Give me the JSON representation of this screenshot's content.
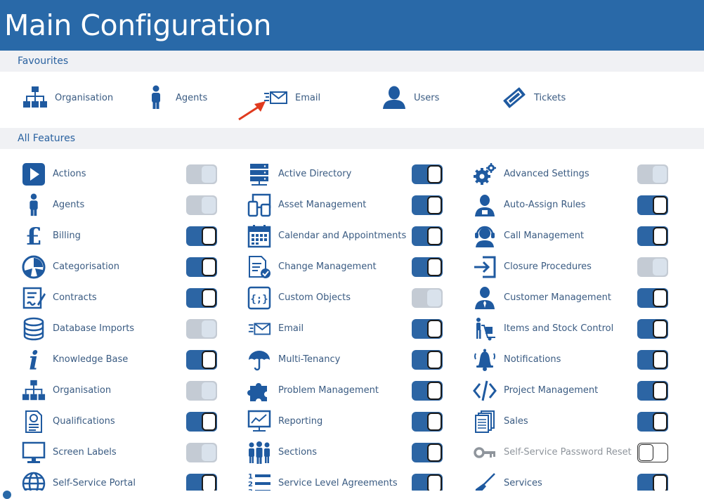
{
  "window": {
    "title": "Main Configuration"
  },
  "colors": {
    "brand": "#2969a8",
    "icon": "#1f5aa0",
    "toggle_on": "#2c65a4",
    "toggle_off": "#c4cbd4"
  },
  "favourites": {
    "heading": "Favourites",
    "items": [
      {
        "label": "Organisation",
        "icon": "org-chart-icon"
      },
      {
        "label": "Agents",
        "icon": "person-icon"
      },
      {
        "label": "Email",
        "icon": "email-icon"
      },
      {
        "label": "Users",
        "icon": "user-icon"
      },
      {
        "label": "Tickets",
        "icon": "ticket-icon"
      }
    ]
  },
  "all_features": {
    "heading": "All Features",
    "columns": [
      [
        {
          "label": "Actions",
          "icon": "play-icon",
          "state": "off"
        },
        {
          "label": "Agents",
          "icon": "person-icon",
          "state": "off"
        },
        {
          "label": "Billing",
          "icon": "pound-icon",
          "state": "on"
        },
        {
          "label": "Categorisation",
          "icon": "pie-chart-icon",
          "state": "on"
        },
        {
          "label": "Contracts",
          "icon": "contract-icon",
          "state": "on"
        },
        {
          "label": "Database Imports",
          "icon": "database-icon",
          "state": "off"
        },
        {
          "label": "Knowledge Base",
          "icon": "info-icon",
          "state": "on"
        },
        {
          "label": "Organisation",
          "icon": "org-chart-icon",
          "state": "off"
        },
        {
          "label": "Qualifications",
          "icon": "certificate-icon",
          "state": "on"
        },
        {
          "label": "Screen Labels",
          "icon": "monitor-icon",
          "state": "off"
        },
        {
          "label": "Self-Service Portal",
          "icon": "globe-icon",
          "state": "on"
        }
      ],
      [
        {
          "label": "Active Directory",
          "icon": "server-icon",
          "state": "on"
        },
        {
          "label": "Asset Management",
          "icon": "devices-icon",
          "state": "on"
        },
        {
          "label": "Calendar and Appointments",
          "icon": "calendar-icon",
          "state": "on"
        },
        {
          "label": "Change Management",
          "icon": "document-check-icon",
          "state": "on"
        },
        {
          "label": "Custom Objects",
          "icon": "code-braces-icon",
          "state": "off"
        },
        {
          "label": "Email",
          "icon": "email-icon",
          "state": "on"
        },
        {
          "label": "Multi-Tenancy",
          "icon": "umbrella-icon",
          "state": "on"
        },
        {
          "label": "Problem Management",
          "icon": "puzzle-icon",
          "state": "on"
        },
        {
          "label": "Reporting",
          "icon": "chart-board-icon",
          "state": "on"
        },
        {
          "label": "Sections",
          "icon": "group-icon",
          "state": "on"
        },
        {
          "label": "Service Level Agreements",
          "icon": "numbered-list-icon",
          "state": "on"
        }
      ],
      [
        {
          "label": "Advanced Settings",
          "icon": "gears-icon",
          "state": "off"
        },
        {
          "label": "Auto-Assign Rules",
          "icon": "agent-assign-icon",
          "state": "on"
        },
        {
          "label": "Call Management",
          "icon": "headset-icon",
          "state": "on"
        },
        {
          "label": "Closure Procedures",
          "icon": "exit-icon",
          "state": "off"
        },
        {
          "label": "Customer Management",
          "icon": "customer-icon",
          "state": "on"
        },
        {
          "label": "Items and Stock Control",
          "icon": "hand-truck-icon",
          "state": "on"
        },
        {
          "label": "Notifications",
          "icon": "bell-icon",
          "state": "on"
        },
        {
          "label": "Project Management",
          "icon": "code-tags-icon",
          "state": "on"
        },
        {
          "label": "Sales",
          "icon": "documents-icon",
          "state": "on"
        },
        {
          "label": "Self-Service Password Reset",
          "icon": "key-icon",
          "state": "blank"
        },
        {
          "label": "Services",
          "icon": "broom-icon",
          "state": "on"
        }
      ]
    ]
  }
}
